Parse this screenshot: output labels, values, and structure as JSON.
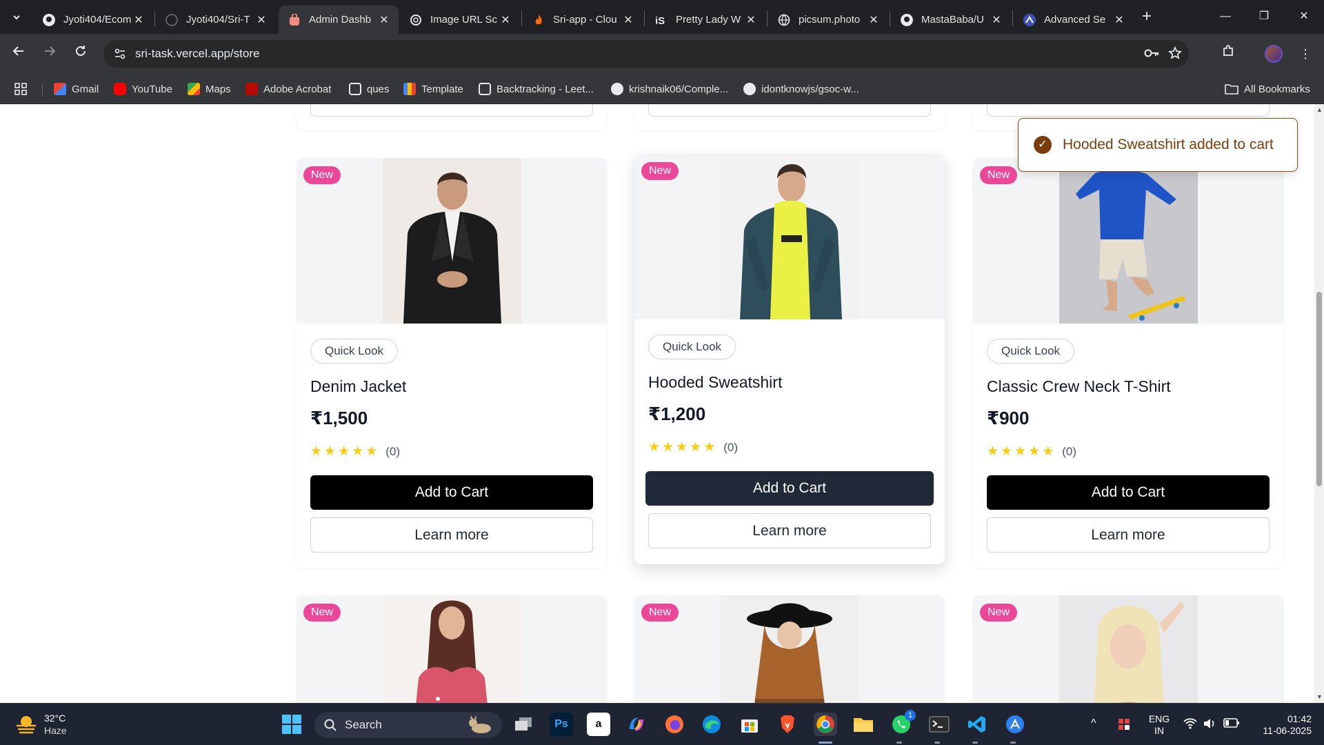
{
  "browser": {
    "tabs": [
      {
        "title": "Jyoti404/Ecom",
        "active": false
      },
      {
        "title": "Jyoti404/Sri-T",
        "active": false
      },
      {
        "title": "Admin Dashb",
        "active": true
      },
      {
        "title": "Image URL Sc",
        "active": false
      },
      {
        "title": "Sri-app - Clou",
        "active": false
      },
      {
        "title": "Pretty Lady W",
        "active": false
      },
      {
        "title": "picsum.photo",
        "active": false
      },
      {
        "title": "MastaBaba/U",
        "active": false
      },
      {
        "title": "Advanced Se",
        "active": false
      }
    ],
    "url": "sri-task.vercel.app/store",
    "bookmarks": [
      "Gmail",
      "YouTube",
      "Maps",
      "Adobe Acrobat",
      "ques",
      "Template",
      "Backtracking - Leet...",
      "krishnaik06/Comple...",
      "idontknowjs/gsoc-w..."
    ],
    "all_bookmarks": "All Bookmarks"
  },
  "store": {
    "toast": "Hooded Sweatshirt added to cart",
    "products": [
      {
        "name": "Denim Jacket",
        "price": "₹1,500",
        "badge": "New",
        "quick_look": "Quick Look",
        "rating_count": "(0)",
        "stars": 5,
        "add_to_cart": "Add to Cart",
        "learn_more": "Learn more"
      },
      {
        "name": "Hooded Sweatshirt",
        "price": "₹1,200",
        "badge": "New",
        "quick_look": "Quick Look",
        "rating_count": "(0)",
        "stars": 5,
        "add_to_cart": "Add to Cart",
        "learn_more": "Learn more"
      },
      {
        "name": "Classic Crew Neck T-Shirt",
        "price": "₹900",
        "badge": "New",
        "quick_look": "Quick Look",
        "rating_count": "(0)",
        "stars": 5,
        "add_to_cart": "Add to Cart",
        "learn_more": "Learn more"
      }
    ],
    "next_row_badges": [
      "New",
      "New",
      "New"
    ]
  },
  "taskbar": {
    "weather_temp": "32°C",
    "weather_cond": "Haze",
    "search": "Search",
    "lang_top": "ENG",
    "lang_bottom": "IN",
    "time": "01:42",
    "date": "11-06-2025",
    "whatsapp_badge": "1"
  },
  "colors": {
    "badge_pink": "#ec4899",
    "toast_brown": "#7a3e0d",
    "star_yellow": "#facc15",
    "add_btn": "#000000",
    "add_btn_hover": "#1f2937"
  }
}
